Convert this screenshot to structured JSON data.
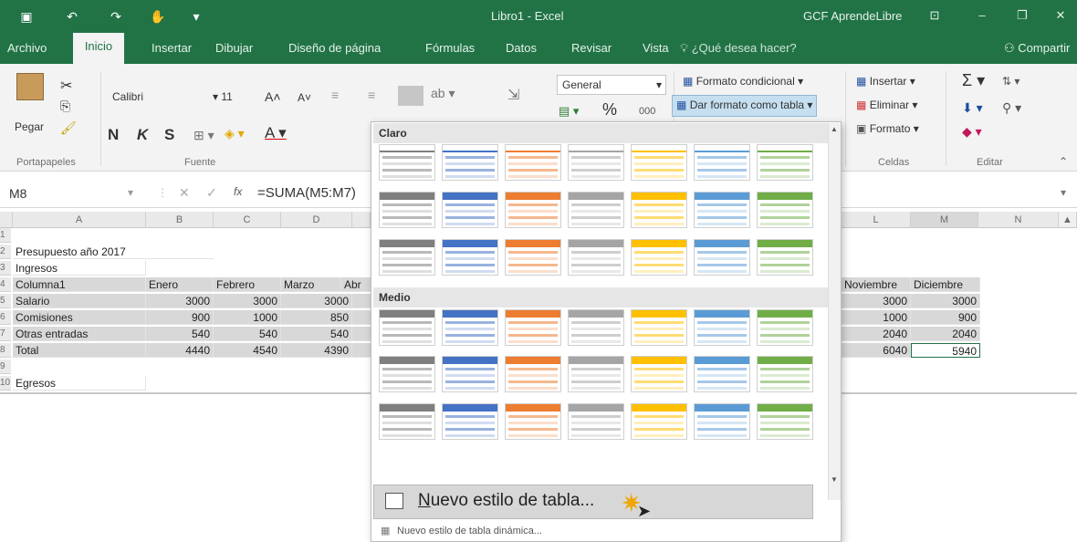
{
  "titlebar": {
    "title": "Libro1  -  Excel",
    "account": "GCF AprendeLibre",
    "qa_icons": [
      "save-icon",
      "undo-icon",
      "redo-icon",
      "touch-mode-icon",
      "customize-icon"
    ]
  },
  "tabs": [
    {
      "label": "Archivo"
    },
    {
      "label": "Inicio"
    },
    {
      "label": "Insertar"
    },
    {
      "label": "Dibujar"
    },
    {
      "label": "Diseño de página"
    },
    {
      "label": "Fórmulas"
    },
    {
      "label": "Datos"
    },
    {
      "label": "Revisar"
    },
    {
      "label": "Vista"
    }
  ],
  "tellme": "¿Qué desea hacer?",
  "share": "Compartir",
  "ribbon": {
    "clipboard": {
      "paste": "Pegar",
      "label": "Portapapeles"
    },
    "font": {
      "name": "Calibri",
      "size": "11",
      "bold": "N",
      "italic": "K",
      "underline": "S",
      "label": "Fuente"
    },
    "number": {
      "format": "General",
      "percent": "%",
      "thousands": "000"
    },
    "styles": {
      "conditional": "Formato condicional",
      "as_table": "Dar formato como tabla"
    },
    "cells": {
      "insert": "Insertar",
      "delete": "Eliminar",
      "format": "Formato",
      "label": "Celdas"
    },
    "editing": {
      "label": "Editar"
    }
  },
  "formulabar": {
    "namebox": "M8",
    "fx": "fx",
    "formula": "=SUMA(M5:M7)"
  },
  "sheet": {
    "columns": [
      "A",
      "B",
      "C",
      "D",
      "L",
      "M",
      "N"
    ],
    "rows": [
      {
        "n": "1",
        "a": "",
        "b": "",
        "c": "",
        "d": "",
        "l": "",
        "m": ""
      },
      {
        "n": "2",
        "a": "Presupuesto año 2017",
        "b": "",
        "c": "",
        "d": "",
        "l": "",
        "m": ""
      },
      {
        "n": "3",
        "a": "Ingresos",
        "b": "",
        "c": "",
        "d": "",
        "l": "",
        "m": ""
      },
      {
        "n": "4",
        "a": "Columna1",
        "b": "Enero",
        "c": "Febrero",
        "d": "Marzo",
        "e": "Abr",
        "l": "Noviembre",
        "m": "Diciembre"
      },
      {
        "n": "5",
        "a": "Salario",
        "b": "3000",
        "c": "3000",
        "d": "3000",
        "l": "3000",
        "m": "3000"
      },
      {
        "n": "6",
        "a": "Comisiones",
        "b": "900",
        "c": "1000",
        "d": "850",
        "l": "1000",
        "m": "900"
      },
      {
        "n": "7",
        "a": "Otras entradas",
        "b": "540",
        "c": "540",
        "d": "540",
        "l": "2040",
        "m": "2040"
      },
      {
        "n": "8",
        "a": "Total",
        "b": "4440",
        "c": "4540",
        "d": "4390",
        "l": "6040",
        "m": "5940"
      },
      {
        "n": "9",
        "a": "",
        "b": "",
        "c": "",
        "d": "",
        "l": "",
        "m": ""
      },
      {
        "n": "10",
        "a": "Egresos",
        "b": "",
        "c": "",
        "d": "",
        "l": "",
        "m": ""
      }
    ]
  },
  "gallery": {
    "section_light": "Claro",
    "section_medium": "Medio",
    "new_table_style_prefix": "N",
    "new_table_style_rest": "uevo estilo de tabla...",
    "new_pivot_style": "Nuevo estilo de tabla dinámica...",
    "palette": [
      "#7f7f7f",
      "#4472c4",
      "#ed7d31",
      "#a5a5a5",
      "#ffc000",
      "#5b9bd5",
      "#70ad47"
    ]
  }
}
